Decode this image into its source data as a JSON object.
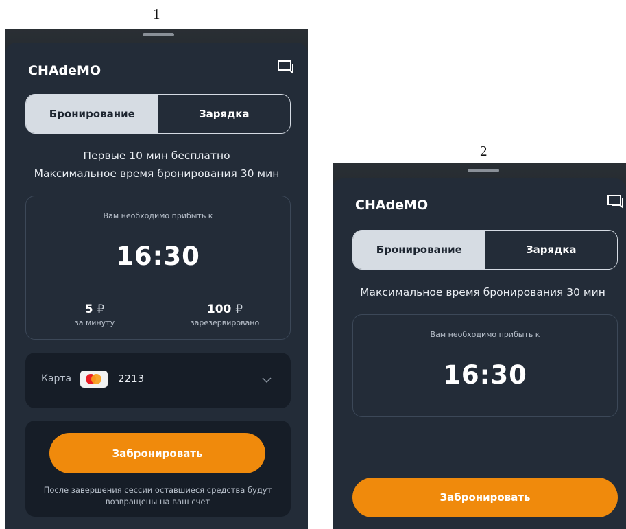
{
  "screens": [
    {
      "figure_number": "1",
      "title": "CHAdeMO",
      "tabs": {
        "booking": "Бронирование",
        "charging": "Зарядка"
      },
      "info_lines": [
        "Первые 10 мин бесплатно",
        "Максимальное время бронирования 30 мин"
      ],
      "arrive_label": "Вам необходимо прибыть к",
      "arrive_time": "16:30",
      "price_per_minute": "5",
      "price_per_minute_label": "за минуту",
      "reserved_amount": "100",
      "reserved_label": "зарезервировано",
      "currency_symbol": "₽",
      "card_label": "Карта",
      "card_number": "2213",
      "book_button": "Забронировать",
      "note": "После завершения сессии оставшиеся средства будут возвращены на ваш счет"
    },
    {
      "figure_number": "2",
      "title": "CHAdeMO",
      "tabs": {
        "booking": "Бронирование",
        "charging": "Зарядка"
      },
      "info_lines": [
        "Максимальное время бронирования 30 мин"
      ],
      "arrive_label": "Вам необходимо прибыть к",
      "arrive_time": "16:30",
      "book_button": "Забронировать"
    }
  ],
  "icons": {
    "chat": "chat-bubbles-icon",
    "chevron": "chevron-down-icon",
    "card_brand": "mastercard-logo-icon"
  },
  "colors": {
    "background": "#232c38",
    "accent": "#f08a0c",
    "segment_active": "#d6dce3"
  }
}
